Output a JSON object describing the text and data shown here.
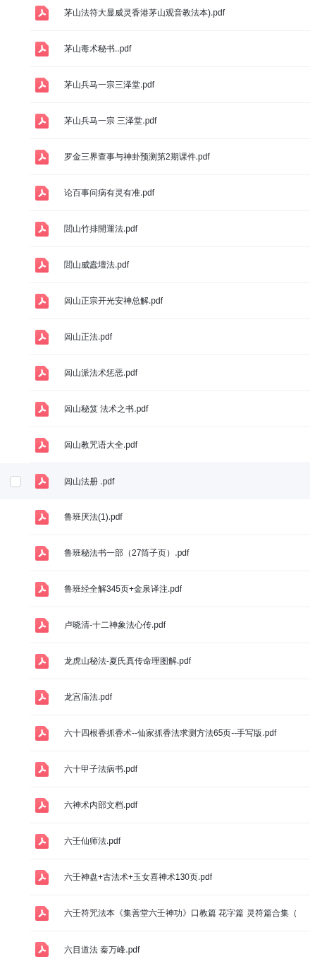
{
  "files": [
    {
      "name": "茅山法符大显威灵香港茅山观音教法本).pdf",
      "hovered": false,
      "checked": false
    },
    {
      "name": "茅山毒术秘书..pdf",
      "hovered": false,
      "checked": false
    },
    {
      "name": "茅山兵马一宗三泽堂.pdf",
      "hovered": false,
      "checked": false
    },
    {
      "name": "茅山兵马一宗 三泽堂.pdf",
      "hovered": false,
      "checked": false
    },
    {
      "name": "罗金三界查事与神卦预测第2期课件.pdf",
      "hovered": false,
      "checked": false
    },
    {
      "name": "论百事问病有灵有准.pdf",
      "hovered": false,
      "checked": false
    },
    {
      "name": "閭山竹排開運法.pdf",
      "hovered": false,
      "checked": false
    },
    {
      "name": "閭山威蠹壇法.pdf",
      "hovered": false,
      "checked": false
    },
    {
      "name": "闾山正宗开光安神总解.pdf",
      "hovered": false,
      "checked": false
    },
    {
      "name": "闾山正法.pdf",
      "hovered": false,
      "checked": false
    },
    {
      "name": "闾山派法术惩恶.pdf",
      "hovered": false,
      "checked": false
    },
    {
      "name": "闾山秘笈 法术之书.pdf",
      "hovered": false,
      "checked": false
    },
    {
      "name": "闾山教咒语大全.pdf",
      "hovered": false,
      "checked": false
    },
    {
      "name": "闾山法册 .pdf",
      "hovered": true,
      "checked": false
    },
    {
      "name": "鲁班厌法(1).pdf",
      "hovered": false,
      "checked": false
    },
    {
      "name": "鲁班秘法书一部（27筒子页）.pdf",
      "hovered": false,
      "checked": false
    },
    {
      "name": "鲁班经全解345页+金泉译注.pdf",
      "hovered": false,
      "checked": false
    },
    {
      "name": "卢晓清-十二神象法心传.pdf",
      "hovered": false,
      "checked": false
    },
    {
      "name": "龙虎山秘法-夏氏真传命理图解.pdf",
      "hovered": false,
      "checked": false
    },
    {
      "name": "龙宫庙法.pdf",
      "hovered": false,
      "checked": false
    },
    {
      "name": "六十四根香抓香术--仙家抓香法求测方法65页--手写版.pdf",
      "hovered": false,
      "checked": false
    },
    {
      "name": "六十甲子法病书.pdf",
      "hovered": false,
      "checked": false
    },
    {
      "name": "六神术内部文档.pdf",
      "hovered": false,
      "checked": false
    },
    {
      "name": "六壬仙师法.pdf",
      "hovered": false,
      "checked": false
    },
    {
      "name": "六壬神盘+古法术+玉女喜神术130页.pdf",
      "hovered": false,
      "checked": false
    },
    {
      "name": "六壬符咒法本《集善堂六壬神功》口教篇 花字篇 灵符篇合集（",
      "hovered": false,
      "checked": false
    },
    {
      "name": "六目道法 秦万峰.pdf",
      "hovered": false,
      "checked": false
    }
  ]
}
